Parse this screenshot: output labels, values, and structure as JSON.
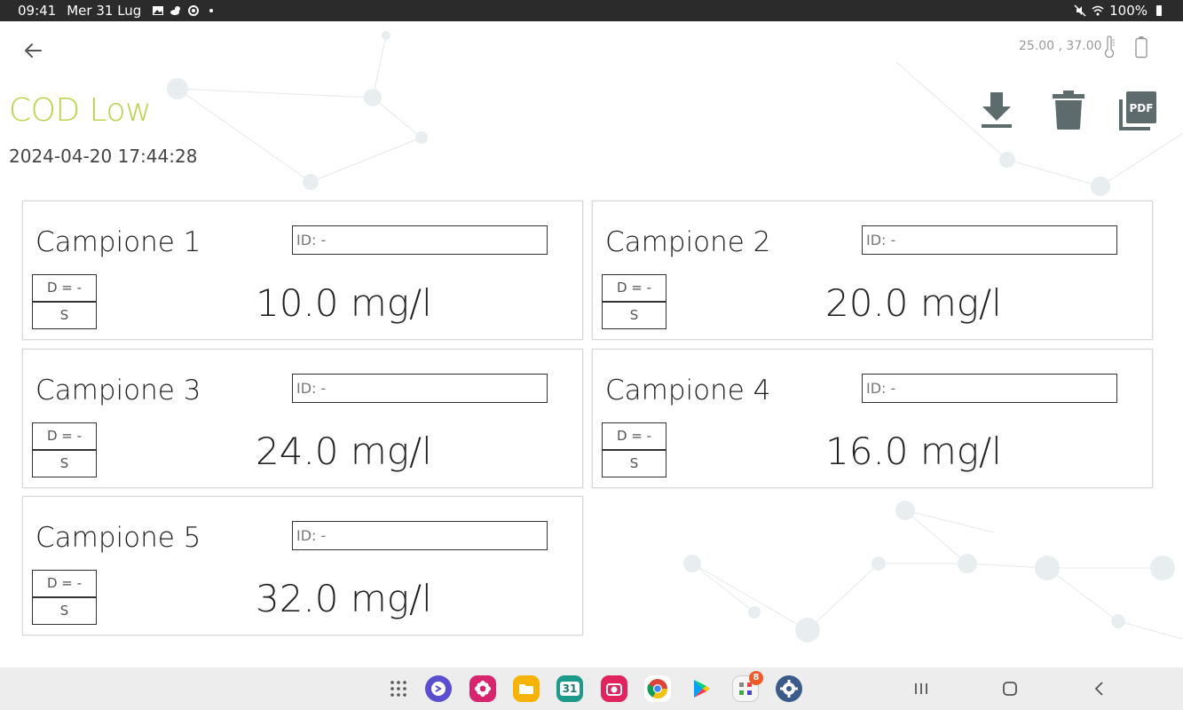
{
  "status_bar": {
    "time": "09:41",
    "date": "Mer 31 Lug",
    "battery": "100%"
  },
  "header": {
    "sensor_values": "25.00 ,  37.00",
    "title": "COD Low",
    "timestamp": "2024-04-20 17:44:28"
  },
  "samples": [
    {
      "name": "Campione 1",
      "id": "ID: -",
      "d": "D = -",
      "s": "S",
      "value": "10.0 mg/l"
    },
    {
      "name": "Campione 2",
      "id": "ID: -",
      "d": "D = -",
      "s": "S",
      "value": "20.0 mg/l"
    },
    {
      "name": "Campione 3",
      "id": "ID: -",
      "d": "D = -",
      "s": "S",
      "value": "24.0 mg/l"
    },
    {
      "name": "Campione 4",
      "id": "ID: -",
      "d": "D = -",
      "s": "S",
      "value": "16.0 mg/l"
    },
    {
      "name": "Campione 5",
      "id": "ID: -",
      "d": "D = -",
      "s": "S",
      "value": "32.0 mg/l"
    }
  ],
  "taskbar": {
    "calendar_day": "31",
    "badge_count": "8"
  },
  "colors": {
    "title": "#bcd246",
    "action_icons": "#5e6b6d",
    "status_bar": "#2b2b2b"
  }
}
